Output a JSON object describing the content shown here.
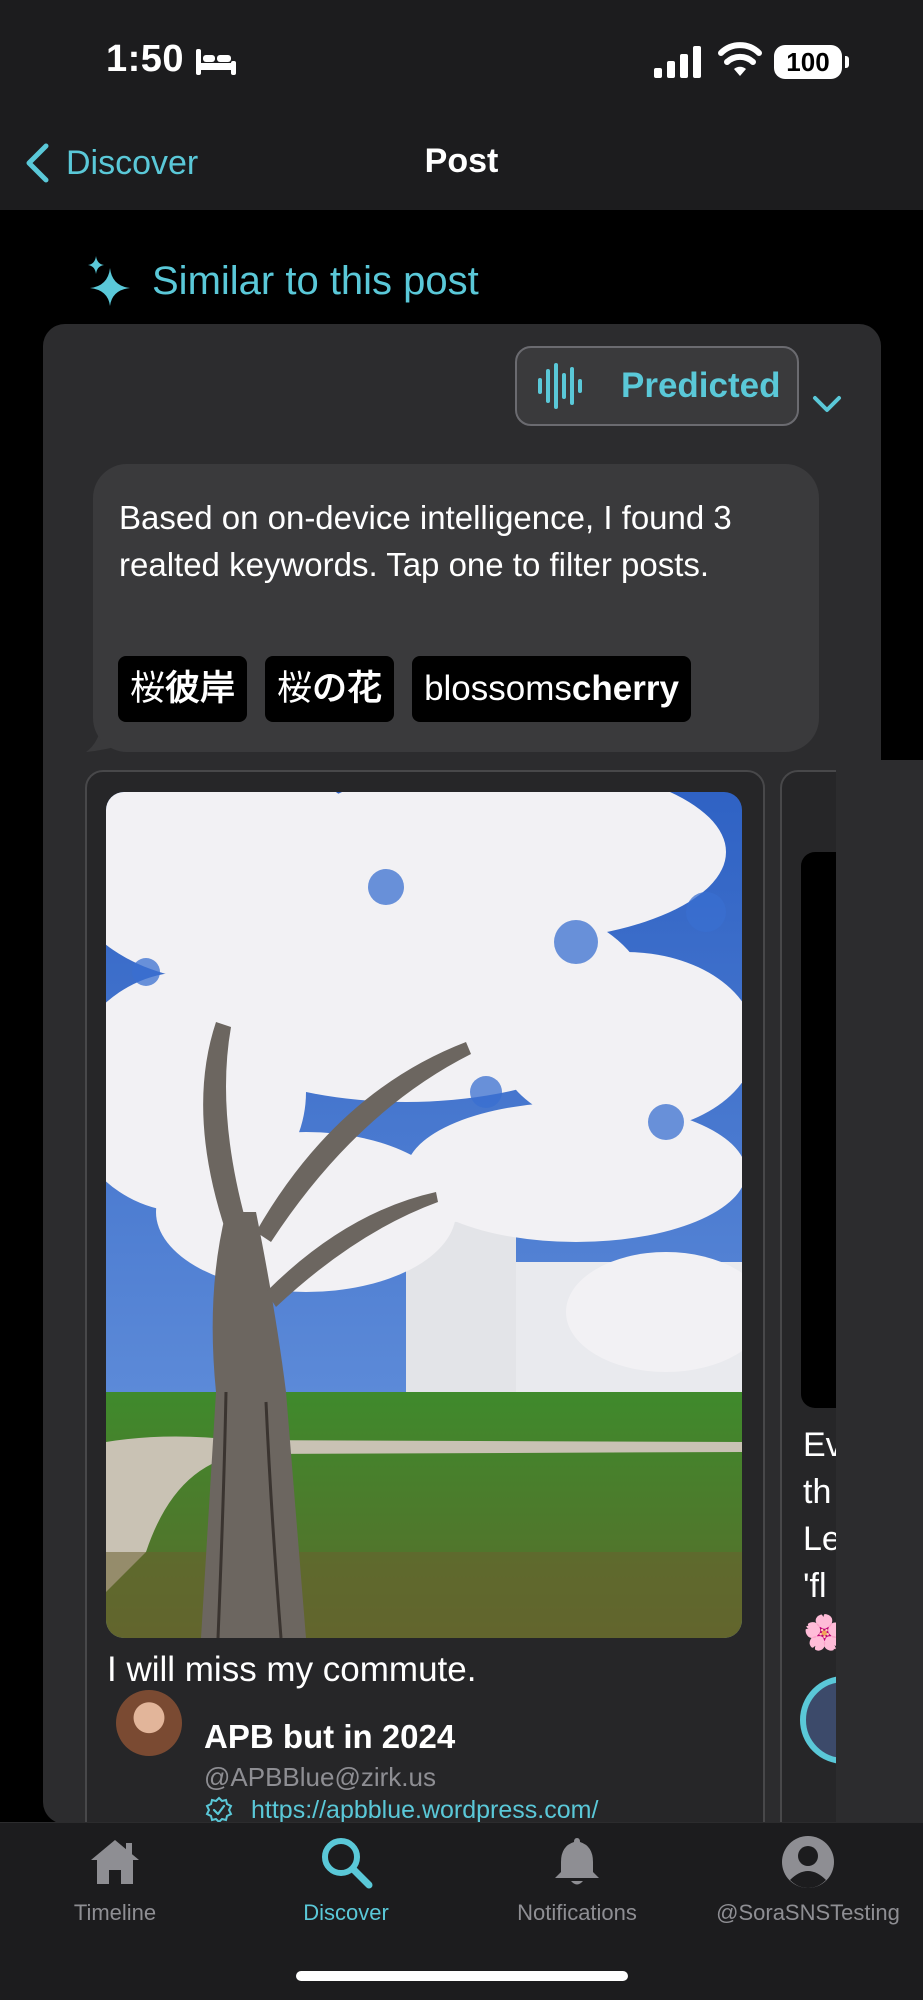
{
  "status_bar": {
    "time": "1:50",
    "battery": "100"
  },
  "nav": {
    "back_label": "Discover",
    "title": "Post"
  },
  "similar": {
    "header": "Similar to this post",
    "mode_label": "Predicted"
  },
  "suggestion": {
    "text": "Based on on-device intelligence, I found 3 realted keywords. Tap one to filter posts.",
    "chips": [
      {
        "plain": "桜",
        "bold": "彼岸"
      },
      {
        "plain": "桜",
        "bold": "の花"
      },
      {
        "plain": "blossoms",
        "bold": "cherry"
      }
    ]
  },
  "post": {
    "caption": "I will miss my commute.",
    "author_name": "APB but in 2024",
    "author_handle": "@APBBlue@zirk.us",
    "author_link": "https://apbblue.wordpress.com/"
  },
  "next_post": {
    "text_fragment": "Ev\nth\nLe\n'fl\n🌸"
  },
  "tabs": [
    {
      "label": "Timeline",
      "icon": "house-icon"
    },
    {
      "label": "Discover",
      "icon": "search-icon"
    },
    {
      "label": "Notifications",
      "icon": "bell-icon"
    },
    {
      "label": "@SoraSNSTesting",
      "icon": "person-icon"
    }
  ],
  "colors": {
    "accent": "#5ac8d8",
    "background": "#000000",
    "panel": "#2c2c2e"
  }
}
